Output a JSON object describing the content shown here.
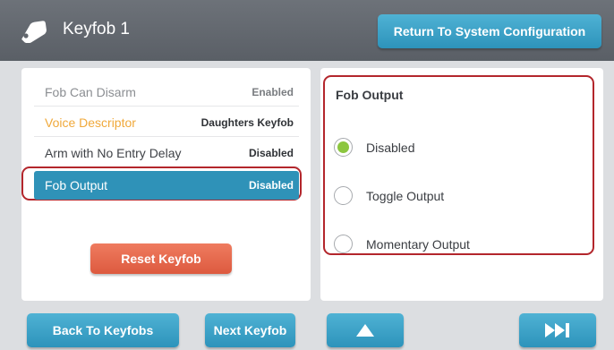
{
  "header": {
    "title": "Keyfob 1",
    "icon": "tag-icon",
    "return_button_label": "Return To System Configuration"
  },
  "settings": {
    "rows": [
      {
        "label": "Fob Can Disarm",
        "value": "Enabled"
      },
      {
        "label": "Voice Descriptor",
        "value": "Daughters Keyfob"
      },
      {
        "label": "Arm with No Entry Delay",
        "value": "Disabled"
      },
      {
        "label": "Fob Output",
        "value": "Disabled"
      }
    ],
    "selected_row": "Fob Output",
    "reset_button_label": "Reset Keyfob"
  },
  "fob_output": {
    "title": "Fob Output",
    "options": [
      {
        "label": "Disabled",
        "selected": true
      },
      {
        "label": "Toggle Output",
        "selected": false
      },
      {
        "label": "Momentary Output",
        "selected": false
      }
    ]
  },
  "footer": {
    "back_label": "Back To Keyfobs",
    "next_label": "Next Keyfob",
    "up_icon": "triangle-up-icon",
    "end_icon": "skip-to-end-icon"
  },
  "colors": {
    "header": "#62676e",
    "accent_blue": "#2f92b8",
    "reset_orange": "#e3654a",
    "highlight_outline": "#b3262c",
    "voice_label": "#f0a93b",
    "radio_selected": "#8cc63f"
  }
}
